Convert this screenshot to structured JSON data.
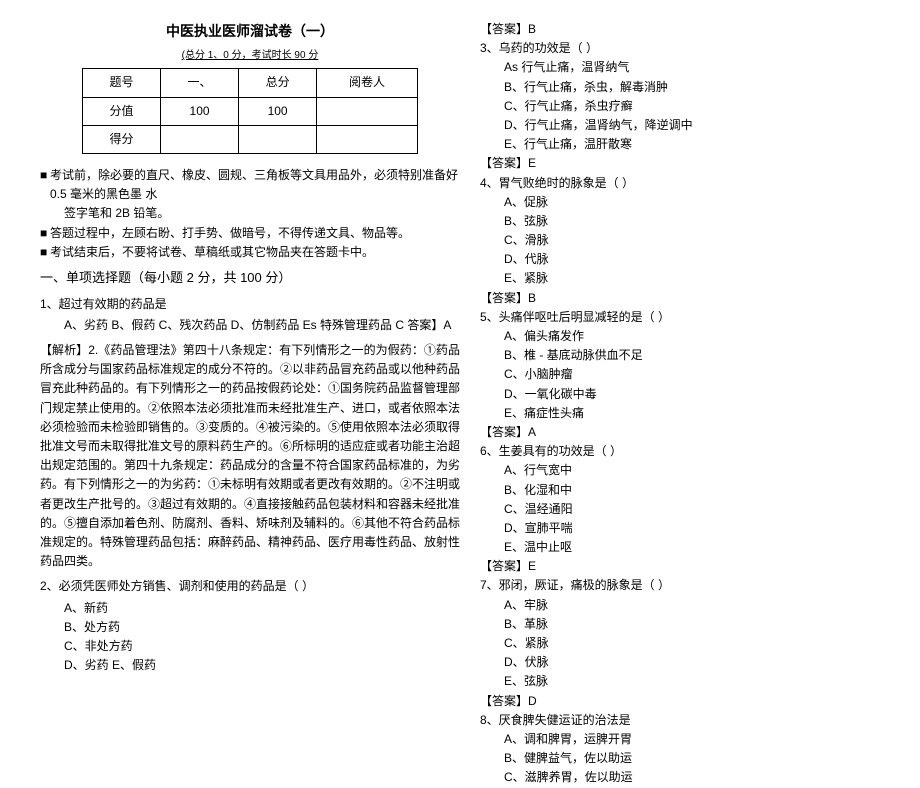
{
  "title": "中医执业医师溜试卷（一）",
  "subtitle": "(总分 1、0 分，考试时长 90 分",
  "table": {
    "r1c1": "题号",
    "r1c2": "一、",
    "r1c3": "总分",
    "r1c4": "阅卷人",
    "r2c1": "分值",
    "r2c2": "100",
    "r2c3": "100",
    "r2c4": "",
    "r3c1": "得分",
    "r3c2": "",
    "r3c3": "",
    "r3c4": ""
  },
  "bullets": {
    "b1a": "考试前，除必要的直尺、橡皮、圆规、三角板等文具用品外，必须特别准备好 0.5 毫米的黑色墨 水",
    "b1b": "签字笔和 2B 铅笔。",
    "b2": "答题过程中，左顾右盼、打手势、做暗号，不得传递文具、物品等。",
    "b3": "考试结束后，不要将试卷、草稿纸或其它物品夹在答题卡中。"
  },
  "section1": "一、单项选择题（每小题 2 分，共 100 分）",
  "q1": {
    "stem": "1、超过有效期的药品是",
    "opts": "A、劣药 B、假药 C、残次药品 D、仿制药品 Es 特殊管理药品 C 答案】A"
  },
  "analysis": "【解析】2.《药品管理法》第四十八条规定：有下列情形之一的为假药：①药品所含成分与国家药品标准规定的成分不符的。②以非药品冒充药品或以他种药品冒充此种药品的。有下列情形之一的药品按假药论处：①国务院药品监督管理部门规定禁止使用的。②依照本法必须批准而未经批准生产、进口，或者依照本法必须检验而未检验即销售的。③变质的。④被污染的。⑤使用依照本法必须取得批准文号而未取得批准文号的原料药生产的。⑥所标明的适应症或者功能主治超出规定范围的。第四十九条规定：药品成分的含量不符合国家药品标准的，为劣药。有下列情形之一的为劣药：①未标明有效期或者更改有效期的。②不注明或者更改生产批号的。③超过有效期的。④直接接触药品包装材料和容器未经批准的。⑤擅自添加着色剂、防腐剂、香料、矫味剂及辅料的。⑥其他不符合药品标准规定的。特殊管理药品包括：麻醉药品、精神药品、医疗用毒性药品、放射性药品四类。",
  "q2": {
    "stem": "2、必须凭医师处方销售、调剂和使用的药品是（ ）",
    "a": "A、新药",
    "b": "B、处方药",
    "c": "C、非处方药",
    "d": "D、劣药 E、假药"
  },
  "right": {
    "ans2": "【答案】B",
    "q3stem": "3、乌药的功效是（ ）",
    "q3a": "As 行气止痛，温肾纳气",
    "q3b": "B、行气止痛，杀虫，解毒消肿",
    "q3c": "C、行气止痛，杀虫疗癣",
    "q3d": "D、行气止痛，温肾纳气，降逆调中",
    "q3e": "E、行气止痛，温肝散寒",
    "ans3": "【答案】E",
    "q4stem": "4、胃气败绝时的脉象是（ ）",
    "q4a": "A、促脉",
    "q4b": "B、弦脉",
    "q4c": "C、滑脉",
    "q4d": "D、代脉",
    "q4e": "E、紧脉",
    "ans4": "【答案】B",
    "q5stem": "5、头痛伴呕吐后明显减轻的是（ ）",
    "q5a": "A、偏头痛发作",
    "q5b": "B、椎 - 基底动脉供血不足",
    "q5c": "C、小脑肿瘤",
    "q5d": "D、一氧化碳中毒",
    "q5e": "E、痛症性头痛",
    "ans5": "【答案】A",
    "q6stem": "6、生姜具有的功效是（ ）",
    "q6a": "A、行气宽中",
    "q6b": "B、化湿和中",
    "q6c": "C、温经通阳",
    "q6d": "D、宣肺平喘",
    "q6e": "E、温中止呕",
    "ans6": "【答案】E",
    "q7stem": "7、邪闭，厥证，痛极的脉象是（ ）",
    "q7a": "A、牢脉",
    "q7b": "B、革脉",
    "q7c": "C、紧脉",
    "q7d": "D、伏脉",
    "q7e": "E、弦脉",
    "ans7": "【答案】D",
    "q8stem": "8、厌食脾失健运证的治法是",
    "q8a": "A、调和脾胃，运脾开胃",
    "q8b": "B、健脾益气，佐以助运",
    "q8c": "C、滋脾养胃，佐以助运"
  }
}
